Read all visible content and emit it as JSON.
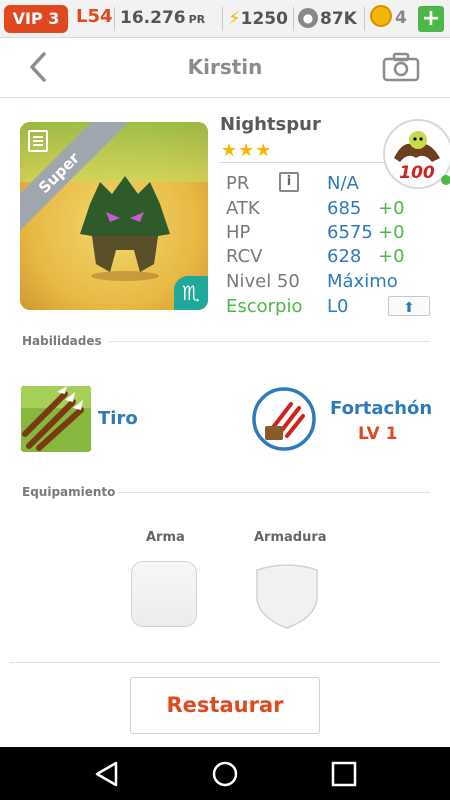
{
  "topbar": {
    "vip": "VIP 3",
    "level": "L54",
    "pr_value": "16.276",
    "pr_unit": "PR",
    "energy": "1250",
    "paws": "87K",
    "coins": "4",
    "plus": "+"
  },
  "header": {
    "title": "Kirstin"
  },
  "monster": {
    "rarity": "Super",
    "zodiac_symbol": "♏",
    "name": "Nightspur",
    "stars": "★★★"
  },
  "emblem": {
    "badge_text": "100"
  },
  "stats": {
    "pr": {
      "label": "PR",
      "value": "N/A"
    },
    "atk": {
      "label": "ATK",
      "value": "685",
      "bonus": "+0"
    },
    "hp": {
      "label": "HP",
      "value": "6575",
      "bonus": "+0"
    },
    "rcv": {
      "label": "RCV",
      "value": "628",
      "bonus": "+0"
    },
    "level": {
      "label": "Nivel 50",
      "value": "Máximo"
    },
    "zodiac": {
      "label": "Escorpio",
      "value": "L0"
    }
  },
  "abilities": {
    "section_label": "Habilidades",
    "skill1": {
      "name": "Tiro"
    },
    "skill2": {
      "name": "Fortachón",
      "level": "LV 1"
    }
  },
  "equipment": {
    "section_label": "Equipamiento",
    "weapon_label": "Arma",
    "armor_label": "Armadura"
  },
  "actions": {
    "restore": "Restaurar"
  },
  "colors": {
    "accent_orange": "#e0481f",
    "link_blue": "#2d7bbd",
    "bonus_green": "#4cb848",
    "star_yellow": "#f2b705"
  }
}
